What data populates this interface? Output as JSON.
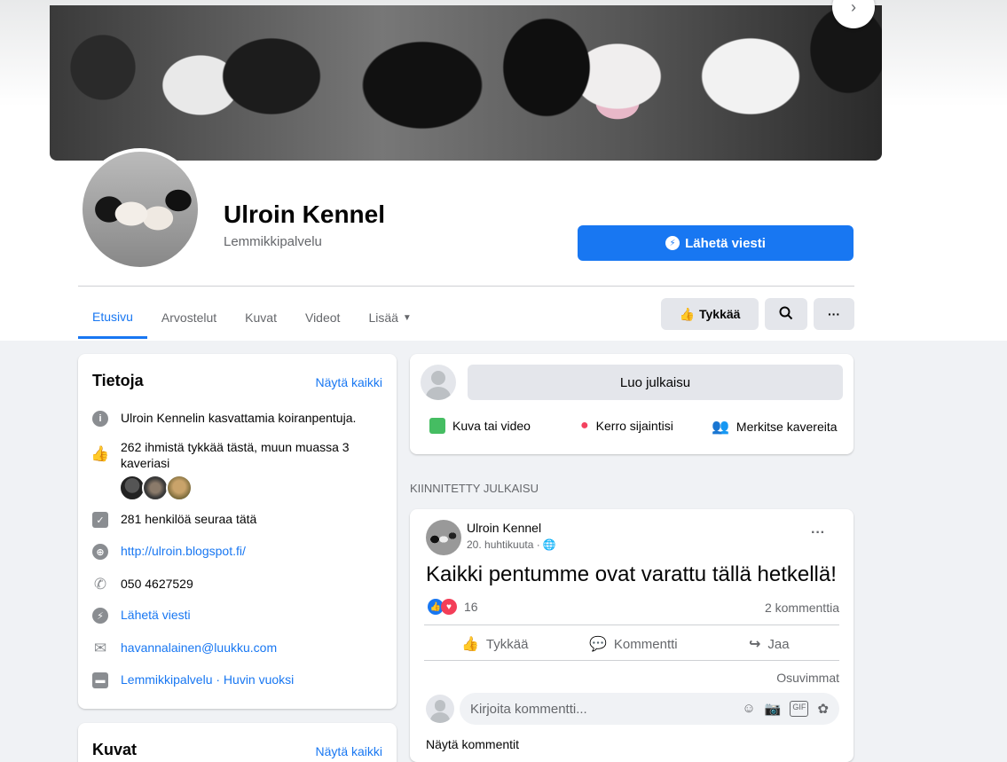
{
  "profile": {
    "name": "Ulroin Kennel",
    "category": "Lemmikkipalvelu",
    "send_message": "Lähetä viesti"
  },
  "tabs": [
    {
      "label": "Etusivu",
      "active": true
    },
    {
      "label": "Arvostelut"
    },
    {
      "label": "Kuvat"
    },
    {
      "label": "Videot"
    },
    {
      "label": "Lisää"
    }
  ],
  "actions": {
    "like": "Tykkää"
  },
  "about": {
    "title": "Tietoja",
    "see_all": "Näytä kaikki",
    "description": "Ulroin Kennelin kasvattamia koiranpentuja.",
    "likes": "262 ihmistä tykkää tästä, muun muassa 3 kaveriasi",
    "followers": "281 henkilöä seuraa tätä",
    "website": "http://ulroin.blogspot.fi/",
    "phone": "050 4627529",
    "send_message": "Lähetä viesti",
    "email": "havannalainen@luukku.com",
    "categories": "Lemmikkipalvelu · Huvin vuoksi"
  },
  "photos": {
    "title": "Kuvat",
    "see_all": "Näytä kaikki"
  },
  "composer": {
    "create_post": "Luo julkaisu",
    "photo_video": "Kuva tai video",
    "location": "Kerro sijaintisi",
    "tag_friends": "Merkitse kavereita"
  },
  "pinned_label": "KIINNITETTY JULKAISU",
  "post": {
    "author": "Ulroin Kennel",
    "date": "20. huhtikuuta ·",
    "text": "Kaikki pentumme ovat varattu tällä hetkellä!",
    "reaction_count": "16",
    "comments_count": "2 kommenttia",
    "like": "Tykkää",
    "comment": "Kommentti",
    "share": "Jaa",
    "sort": "Osuvimmat",
    "comment_placeholder": "Kirjoita kommentti...",
    "show_comments": "Näytä kommentit"
  },
  "colors": {
    "accent": "#1877f2",
    "background": "#f0f2f5"
  }
}
